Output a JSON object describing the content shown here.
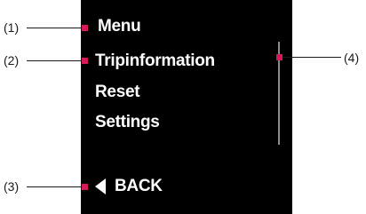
{
  "screen": {
    "title": "Menu",
    "items": [
      {
        "label": "Tripinformation"
      },
      {
        "label": "Reset"
      },
      {
        "label": "Settings"
      }
    ],
    "back_label": "BACK",
    "back_icon": "left-triangle-icon"
  },
  "callouts": [
    {
      "label": "(1)"
    },
    {
      "label": "(2)"
    },
    {
      "label": "(3)"
    },
    {
      "label": "(4)"
    }
  ],
  "colors": {
    "screen_background": "#000000",
    "text": "#ffffff",
    "marker": "#d6195c",
    "scrollbar": "#8a8a8a",
    "leader_line": "#1a1a1a"
  }
}
